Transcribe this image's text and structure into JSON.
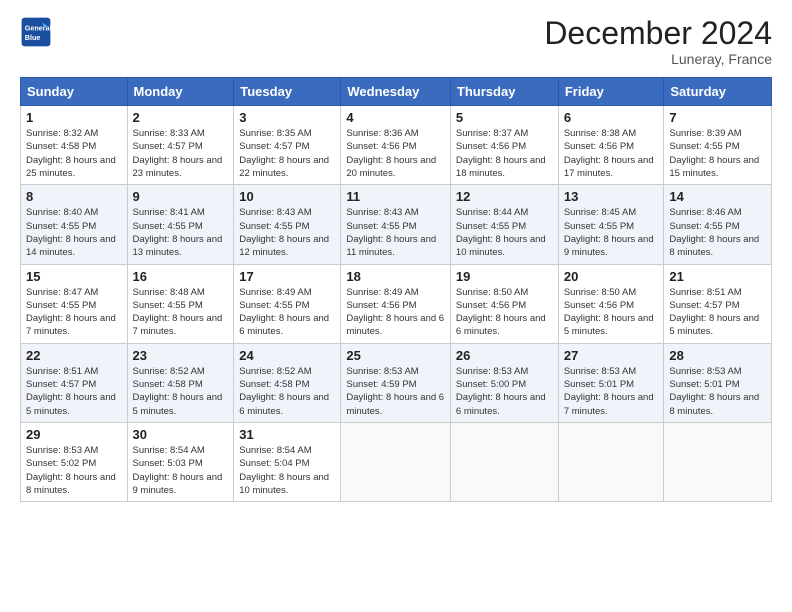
{
  "header": {
    "logo_line1": "General",
    "logo_line2": "Blue",
    "month_title": "December 2024",
    "location": "Luneray, France"
  },
  "columns": [
    "Sunday",
    "Monday",
    "Tuesday",
    "Wednesday",
    "Thursday",
    "Friday",
    "Saturday"
  ],
  "weeks": [
    [
      {
        "day": "1",
        "info": "Sunrise: 8:32 AM\nSunset: 4:58 PM\nDaylight: 8 hours and 25 minutes."
      },
      {
        "day": "2",
        "info": "Sunrise: 8:33 AM\nSunset: 4:57 PM\nDaylight: 8 hours and 23 minutes."
      },
      {
        "day": "3",
        "info": "Sunrise: 8:35 AM\nSunset: 4:57 PM\nDaylight: 8 hours and 22 minutes."
      },
      {
        "day": "4",
        "info": "Sunrise: 8:36 AM\nSunset: 4:56 PM\nDaylight: 8 hours and 20 minutes."
      },
      {
        "day": "5",
        "info": "Sunrise: 8:37 AM\nSunset: 4:56 PM\nDaylight: 8 hours and 18 minutes."
      },
      {
        "day": "6",
        "info": "Sunrise: 8:38 AM\nSunset: 4:56 PM\nDaylight: 8 hours and 17 minutes."
      },
      {
        "day": "7",
        "info": "Sunrise: 8:39 AM\nSunset: 4:55 PM\nDaylight: 8 hours and 15 minutes."
      }
    ],
    [
      {
        "day": "8",
        "info": "Sunrise: 8:40 AM\nSunset: 4:55 PM\nDaylight: 8 hours and 14 minutes."
      },
      {
        "day": "9",
        "info": "Sunrise: 8:41 AM\nSunset: 4:55 PM\nDaylight: 8 hours and 13 minutes."
      },
      {
        "day": "10",
        "info": "Sunrise: 8:43 AM\nSunset: 4:55 PM\nDaylight: 8 hours and 12 minutes."
      },
      {
        "day": "11",
        "info": "Sunrise: 8:43 AM\nSunset: 4:55 PM\nDaylight: 8 hours and 11 minutes."
      },
      {
        "day": "12",
        "info": "Sunrise: 8:44 AM\nSunset: 4:55 PM\nDaylight: 8 hours and 10 minutes."
      },
      {
        "day": "13",
        "info": "Sunrise: 8:45 AM\nSunset: 4:55 PM\nDaylight: 8 hours and 9 minutes."
      },
      {
        "day": "14",
        "info": "Sunrise: 8:46 AM\nSunset: 4:55 PM\nDaylight: 8 hours and 8 minutes."
      }
    ],
    [
      {
        "day": "15",
        "info": "Sunrise: 8:47 AM\nSunset: 4:55 PM\nDaylight: 8 hours and 7 minutes."
      },
      {
        "day": "16",
        "info": "Sunrise: 8:48 AM\nSunset: 4:55 PM\nDaylight: 8 hours and 7 minutes."
      },
      {
        "day": "17",
        "info": "Sunrise: 8:49 AM\nSunset: 4:55 PM\nDaylight: 8 hours and 6 minutes."
      },
      {
        "day": "18",
        "info": "Sunrise: 8:49 AM\nSunset: 4:56 PM\nDaylight: 8 hours and 6 minutes."
      },
      {
        "day": "19",
        "info": "Sunrise: 8:50 AM\nSunset: 4:56 PM\nDaylight: 8 hours and 6 minutes."
      },
      {
        "day": "20",
        "info": "Sunrise: 8:50 AM\nSunset: 4:56 PM\nDaylight: 8 hours and 5 minutes."
      },
      {
        "day": "21",
        "info": "Sunrise: 8:51 AM\nSunset: 4:57 PM\nDaylight: 8 hours and 5 minutes."
      }
    ],
    [
      {
        "day": "22",
        "info": "Sunrise: 8:51 AM\nSunset: 4:57 PM\nDaylight: 8 hours and 5 minutes."
      },
      {
        "day": "23",
        "info": "Sunrise: 8:52 AM\nSunset: 4:58 PM\nDaylight: 8 hours and 5 minutes."
      },
      {
        "day": "24",
        "info": "Sunrise: 8:52 AM\nSunset: 4:58 PM\nDaylight: 8 hours and 6 minutes."
      },
      {
        "day": "25",
        "info": "Sunrise: 8:53 AM\nSunset: 4:59 PM\nDaylight: 8 hours and 6 minutes."
      },
      {
        "day": "26",
        "info": "Sunrise: 8:53 AM\nSunset: 5:00 PM\nDaylight: 8 hours and 6 minutes."
      },
      {
        "day": "27",
        "info": "Sunrise: 8:53 AM\nSunset: 5:01 PM\nDaylight: 8 hours and 7 minutes."
      },
      {
        "day": "28",
        "info": "Sunrise: 8:53 AM\nSunset: 5:01 PM\nDaylight: 8 hours and 8 minutes."
      }
    ],
    [
      {
        "day": "29",
        "info": "Sunrise: 8:53 AM\nSunset: 5:02 PM\nDaylight: 8 hours and 8 minutes."
      },
      {
        "day": "30",
        "info": "Sunrise: 8:54 AM\nSunset: 5:03 PM\nDaylight: 8 hours and 9 minutes."
      },
      {
        "day": "31",
        "info": "Sunrise: 8:54 AM\nSunset: 5:04 PM\nDaylight: 8 hours and 10 minutes."
      },
      {
        "day": "",
        "info": ""
      },
      {
        "day": "",
        "info": ""
      },
      {
        "day": "",
        "info": ""
      },
      {
        "day": "",
        "info": ""
      }
    ]
  ]
}
